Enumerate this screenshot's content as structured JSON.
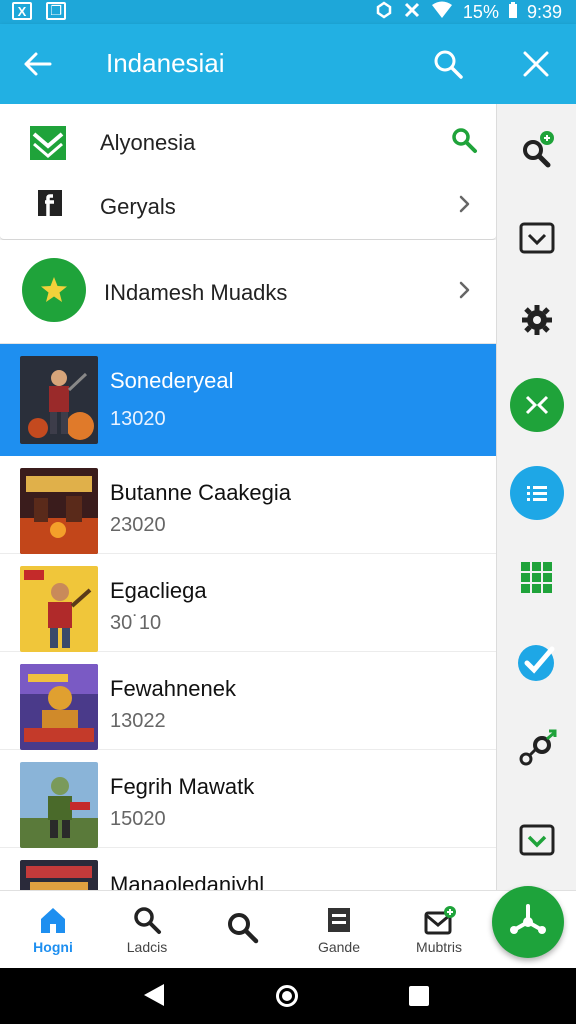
{
  "status_bar": {
    "left_icons": [
      "x-box-icon",
      "image-box-icon"
    ],
    "left_glyphs": [
      "X",
      "❐"
    ],
    "battery": "15%",
    "time": "9:39"
  },
  "app_bar": {
    "title": "Indanesiai"
  },
  "menu": [
    {
      "label": "Alyonesia",
      "icon": "chevron-badge-icon",
      "trailing": "search-icon"
    },
    {
      "label": "Geryals",
      "icon": "facebook-icon",
      "trailing": "chevron-right-icon"
    }
  ],
  "feature": {
    "label": "INdamesh Muadks",
    "icon": "star-icon"
  },
  "items": [
    {
      "title": "Sonederyeal",
      "sub": "13020",
      "selected": true
    },
    {
      "title": "Butanne Caakegia",
      "sub": "23020",
      "selected": false
    },
    {
      "title": "Egacliega",
      "sub": "30˙10",
      "selected": false
    },
    {
      "title": "Fewahnenek",
      "sub": "13022",
      "selected": false
    },
    {
      "title": "Fegrih Mawatk",
      "sub": "15020",
      "selected": false
    },
    {
      "title": "Manaoledaniyhl",
      "sub": "",
      "selected": false
    }
  ],
  "rail_icons": [
    "search-badge-icon",
    "dropdown-box-icon",
    "gear-icon",
    "share-x-icon",
    "list-icon",
    "grid-icon",
    "check-circle-icon",
    "connect-icon",
    "inbox-check-icon"
  ],
  "bottom_nav": [
    {
      "label": "Hogni",
      "icon": "home-icon",
      "active": true
    },
    {
      "label": "Ladcis",
      "icon": "search-icon",
      "active": false
    },
    {
      "label": "",
      "icon": "search-icon",
      "active": false
    },
    {
      "label": "Gande",
      "icon": "document-icon",
      "active": false
    },
    {
      "label": "Mubtris",
      "icon": "mail-badge-icon",
      "active": false
    }
  ],
  "colors": {
    "app_bar": "#22b0e3",
    "selected": "#1e8ff0",
    "accent_green": "#1fa33a",
    "accent_blue": "#1ea7e6"
  }
}
